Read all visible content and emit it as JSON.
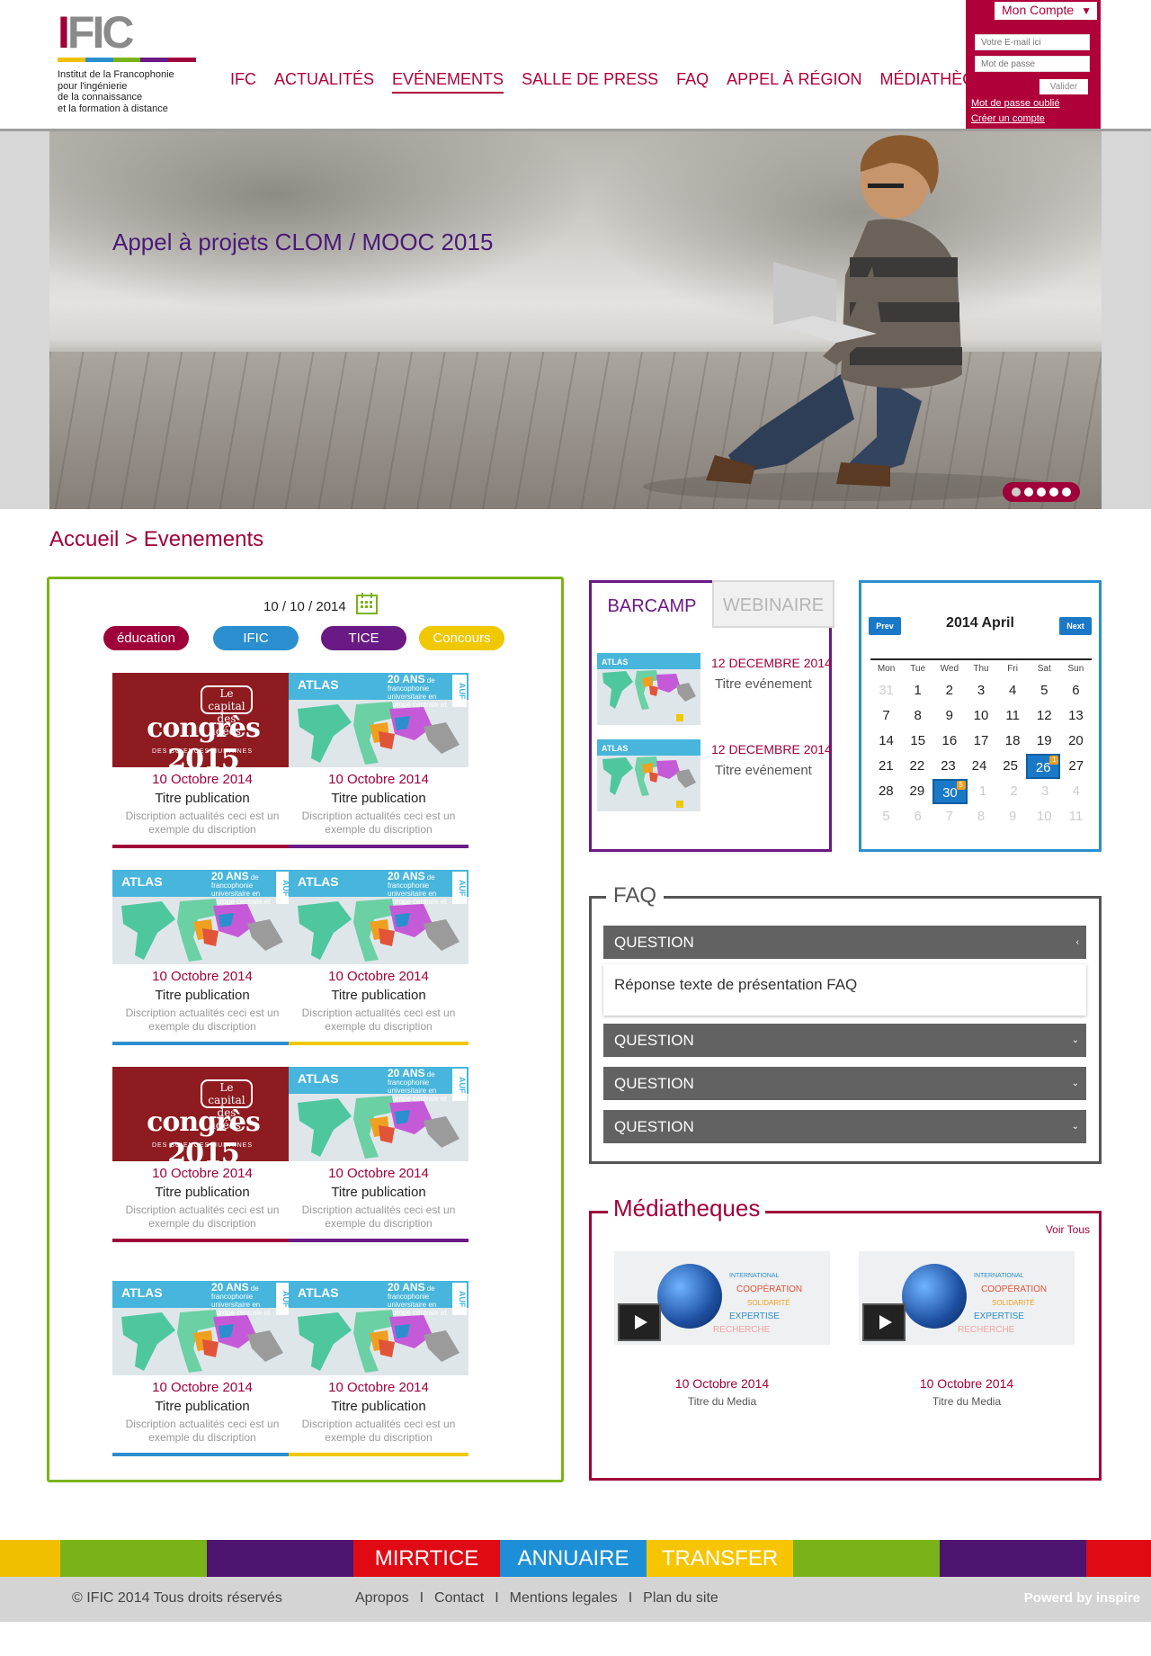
{
  "header": {
    "logo": {
      "name": "IFIC",
      "subtitle_lines": [
        "Institut de la Francophonie",
        "pour l'ingénierie",
        "de la connaissance",
        "et la formation à distance"
      ],
      "stripe_colors": [
        "#f0c000",
        "#2b8fcf",
        "#7ab317",
        "#6a1a84",
        "#a0003a"
      ]
    },
    "nav": [
      "IFC",
      "ACTUALITÉS",
      "EVÉNEMENTS",
      "SALLE DE PRESS",
      "FAQ",
      "APPEL À RÉGION",
      "MÉDIATHÈQUE"
    ],
    "nav_active": "EVÉNEMENTS",
    "account": {
      "title": "Mon Compte",
      "email_placeholder": "Votre E-mail ici",
      "password_placeholder": "Mot de passe",
      "submit": "Valider",
      "forgot": "Mot de passe oublié",
      "create": "Créer un compte"
    }
  },
  "hero": {
    "title": "Appel à projets CLOM / MOOC 2015",
    "slides": 5,
    "active_slide": 1
  },
  "breadcrumb": "Accueil > Evenements",
  "events": {
    "date": "10 / 10 / 2014",
    "filters": [
      {
        "label": "éducation",
        "color": "#a0003a"
      },
      {
        "label": "IFIC",
        "color": "#2b8fcf"
      },
      {
        "label": "TICE",
        "color": "#6a1a84"
      },
      {
        "label": "Concours",
        "color": "#f0c800"
      }
    ],
    "thumb_texts": {
      "congres_bubble": "Le capital des idées",
      "congres_title": "congrès 2015",
      "congres_sub": "DES SCIENCES HUMAINES",
      "atlas_label": "ATLAS",
      "atlas_years": "20 ANS",
      "atlas_sub": "de francophonie universitaire en Europe centrale et orientale",
      "atlas_brand": "AUF"
    },
    "cards": [
      {
        "image": "congres",
        "date": "10 Octobre 2014",
        "title": "Titre publication",
        "desc": "Discription actualités ceci est un exemple du discription",
        "color": "#a0003a"
      },
      {
        "image": "atlas",
        "date": "10 Octobre 2014",
        "title": "Titre publication",
        "desc": "Discription actualités ceci est un exemple du discription",
        "color": "#6a1a84"
      },
      {
        "image": "atlas",
        "date": "10 Octobre 2014",
        "title": "Titre publication",
        "desc": "Discription actualités ceci est un exemple du discription",
        "color": "#2b8fcf"
      },
      {
        "image": "atlas",
        "date": "10 Octobre 2014",
        "title": "Titre publication",
        "desc": "Discription actualités ceci est un exemple du discription",
        "color": "#f0c800"
      },
      {
        "image": "congres",
        "date": "10 Octobre 2014",
        "title": "Titre publication",
        "desc": "Discription actualités ceci est un exemple du discription",
        "color": "#a0003a"
      },
      {
        "image": "atlas",
        "date": "10 Octobre 2014",
        "title": "Titre publication",
        "desc": "Discription actualités ceci est un exemple du discription",
        "color": "#6a1a84"
      },
      {
        "image": "atlas",
        "date": "10 Octobre 2014",
        "title": "Titre publication",
        "desc": "Discription actualités ceci est un exemple du discription",
        "color": "#2b8fcf"
      },
      {
        "image": "atlas",
        "date": "10 Octobre 2014",
        "title": "Titre publication",
        "desc": "Discription actualités ceci est un exemple du discription",
        "color": "#f0c800"
      }
    ]
  },
  "barcamp": {
    "tabs": [
      "BARCAMP",
      "WEBINAIRE"
    ],
    "items": [
      {
        "date": "12 DECEMBRE 2014",
        "title": "Titre evénement"
      },
      {
        "date": "12 DECEMBRE 2014",
        "title": "Titre evénement"
      }
    ]
  },
  "calendar": {
    "prev": "Prev",
    "next": "Next",
    "month": "2014 April",
    "weekdays": [
      "Mon",
      "Tue",
      "Wed",
      "Thu",
      "Fri",
      "Sat",
      "Sun"
    ],
    "weeks": [
      [
        "31",
        "1",
        "2",
        "3",
        "4",
        "5",
        "6"
      ],
      [
        "7",
        "8",
        "9",
        "10",
        "11",
        "12",
        "13"
      ],
      [
        "14",
        "15",
        "16",
        "17",
        "18",
        "19",
        "20"
      ],
      [
        "21",
        "22",
        "23",
        "24",
        "25",
        "26",
        "27"
      ],
      [
        "28",
        "29",
        "30",
        "1",
        "2",
        "3",
        "4"
      ],
      [
        "5",
        "6",
        "7",
        "8",
        "9",
        "10",
        "11"
      ]
    ],
    "highlighted": [
      {
        "day": "26",
        "badge": "1"
      },
      {
        "day": "30",
        "badge": "5"
      }
    ]
  },
  "faq": {
    "title": "FAQ",
    "items": [
      {
        "question": "QUESTION",
        "open": true,
        "answer": "Réponse texte de présentation FAQ"
      },
      {
        "question": "QUESTION",
        "open": false
      },
      {
        "question": "QUESTION",
        "open": false
      },
      {
        "question": "QUESTION",
        "open": false
      }
    ]
  },
  "media": {
    "title": "Médiatheques",
    "view_all": "Voir Tous",
    "thumb_words": [
      "INTERNATIONAL",
      "COOPÉRATION",
      "SOLIDARITÉ",
      "EXPERTISE",
      "RECHERCHE"
    ],
    "items": [
      {
        "date": "10 Octobre 2014",
        "title": "Titre du Media"
      },
      {
        "date": "10 Octobre 2014",
        "title": "Titre du Media"
      }
    ]
  },
  "footer": {
    "bar_colors": [
      "#f0c000",
      "#7ab317",
      "#4d1470",
      "#e00a14",
      "#1d8fd6",
      "#f7c500",
      "#7ab317",
      "#4d1470",
      "#e00a14"
    ],
    "bar_links": [
      "MIRRTICE",
      "ANNUAIRE",
      "TRANSFER"
    ],
    "copyright": "© IFIC 2014  Tous droits réservés",
    "links": [
      "Apropos",
      "Contact",
      "Mentions legales",
      "Plan du site"
    ],
    "powered": "Powerd by inspire"
  }
}
